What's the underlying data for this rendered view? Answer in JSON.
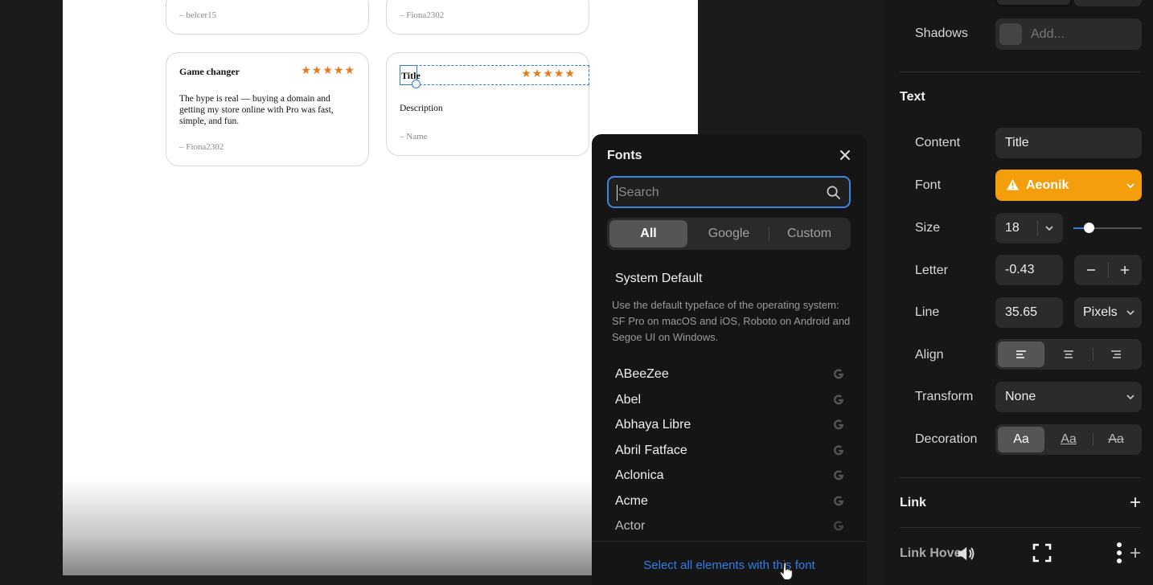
{
  "canvas": {
    "cards": [
      {
        "signature": "– belcer15"
      },
      {
        "signature": "– Fiona2302"
      },
      {
        "title": "Game changer",
        "stars": "★★★★★",
        "body": "The hype is real — buying a domain and getting my store online with Pro was fast, simple, and fun.",
        "signature": "– Fiona2302"
      },
      {
        "title": "Title",
        "stars": "★★★★★",
        "body": "Description",
        "signature": "– Name"
      }
    ]
  },
  "fonts_popup": {
    "title": "Fonts",
    "search_placeholder": "Search",
    "tabs": [
      "All",
      "Google",
      "Custom"
    ],
    "active_tab": "All",
    "system_default": {
      "label": "System Default",
      "description": "Use the default typeface of the operating system: SF Pro on macOS and iOS, Roboto on Android and Segoe UI on Windows."
    },
    "fonts": [
      "ABeeZee",
      "Abel",
      "Abhaya Libre",
      "Abril Fatface",
      "Aclonica",
      "Acme",
      "Actor"
    ],
    "footer_link": "Select all elements with this font"
  },
  "panel": {
    "shadows": {
      "label": "Shadows",
      "value": "Add..."
    },
    "text_section": "Text",
    "content": {
      "label": "Content",
      "value": "Title"
    },
    "font": {
      "label": "Font",
      "value": "Aeonik",
      "color": "#f59e0b"
    },
    "size": {
      "label": "Size",
      "value": "18",
      "slider_fraction": 0.22
    },
    "letter": {
      "label": "Letter",
      "value": "-0.43"
    },
    "line": {
      "label": "Line",
      "value": "35.65",
      "unit": "Pixels"
    },
    "align": {
      "label": "Align",
      "active": "left"
    },
    "transform": {
      "label": "Transform",
      "value": "None"
    },
    "decoration": {
      "label": "Decoration",
      "options": [
        "Aa",
        "Aa",
        "Aa"
      ]
    },
    "link_section": "Link",
    "link_hover_section": "Link Hover"
  }
}
